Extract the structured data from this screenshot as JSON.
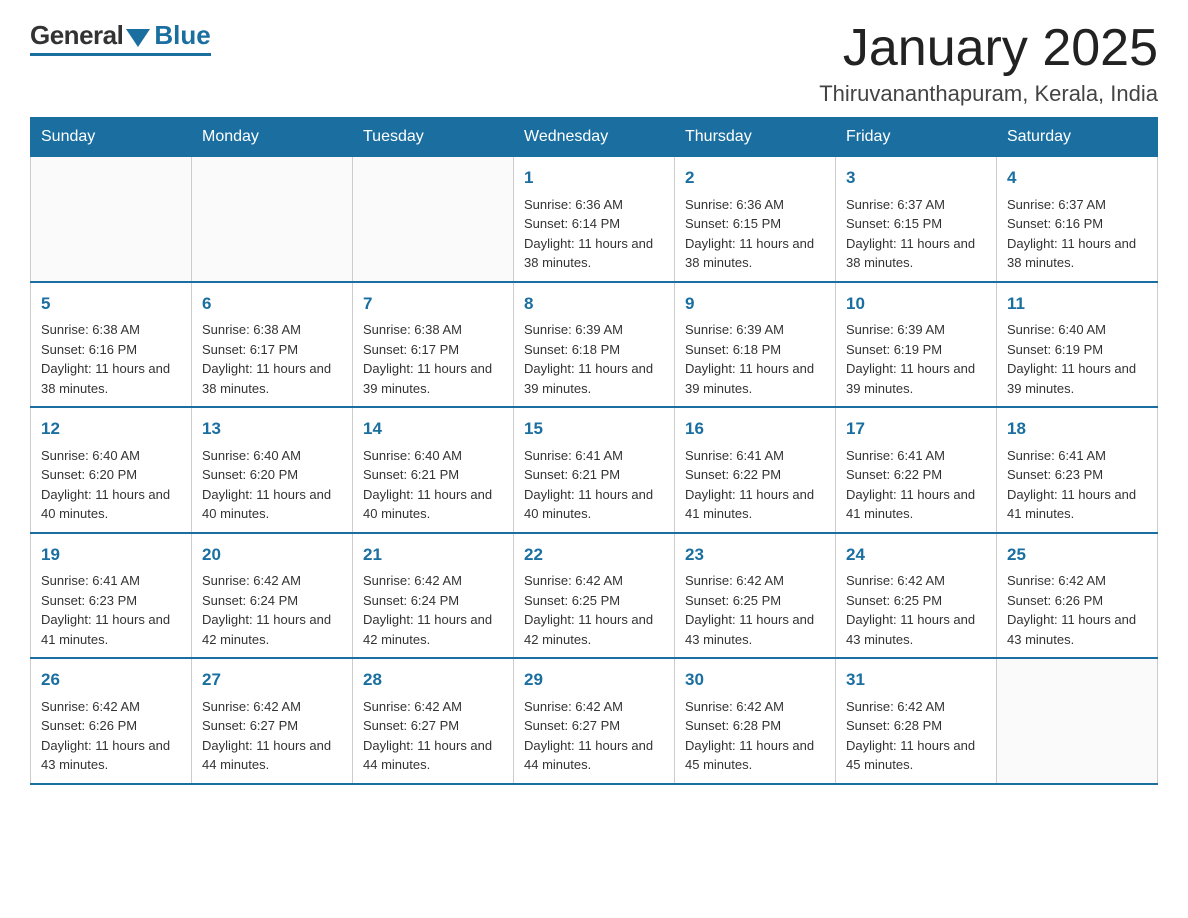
{
  "header": {
    "logo_general": "General",
    "logo_blue": "Blue",
    "month_title": "January 2025",
    "location": "Thiruvananthapuram, Kerala, India"
  },
  "days_of_week": [
    "Sunday",
    "Monday",
    "Tuesday",
    "Wednesday",
    "Thursday",
    "Friday",
    "Saturday"
  ],
  "weeks": [
    [
      {
        "day": "",
        "info": ""
      },
      {
        "day": "",
        "info": ""
      },
      {
        "day": "",
        "info": ""
      },
      {
        "day": "1",
        "info": "Sunrise: 6:36 AM\nSunset: 6:14 PM\nDaylight: 11 hours and 38 minutes."
      },
      {
        "day": "2",
        "info": "Sunrise: 6:36 AM\nSunset: 6:15 PM\nDaylight: 11 hours and 38 minutes."
      },
      {
        "day": "3",
        "info": "Sunrise: 6:37 AM\nSunset: 6:15 PM\nDaylight: 11 hours and 38 minutes."
      },
      {
        "day": "4",
        "info": "Sunrise: 6:37 AM\nSunset: 6:16 PM\nDaylight: 11 hours and 38 minutes."
      }
    ],
    [
      {
        "day": "5",
        "info": "Sunrise: 6:38 AM\nSunset: 6:16 PM\nDaylight: 11 hours and 38 minutes."
      },
      {
        "day": "6",
        "info": "Sunrise: 6:38 AM\nSunset: 6:17 PM\nDaylight: 11 hours and 38 minutes."
      },
      {
        "day": "7",
        "info": "Sunrise: 6:38 AM\nSunset: 6:17 PM\nDaylight: 11 hours and 39 minutes."
      },
      {
        "day": "8",
        "info": "Sunrise: 6:39 AM\nSunset: 6:18 PM\nDaylight: 11 hours and 39 minutes."
      },
      {
        "day": "9",
        "info": "Sunrise: 6:39 AM\nSunset: 6:18 PM\nDaylight: 11 hours and 39 minutes."
      },
      {
        "day": "10",
        "info": "Sunrise: 6:39 AM\nSunset: 6:19 PM\nDaylight: 11 hours and 39 minutes."
      },
      {
        "day": "11",
        "info": "Sunrise: 6:40 AM\nSunset: 6:19 PM\nDaylight: 11 hours and 39 minutes."
      }
    ],
    [
      {
        "day": "12",
        "info": "Sunrise: 6:40 AM\nSunset: 6:20 PM\nDaylight: 11 hours and 40 minutes."
      },
      {
        "day": "13",
        "info": "Sunrise: 6:40 AM\nSunset: 6:20 PM\nDaylight: 11 hours and 40 minutes."
      },
      {
        "day": "14",
        "info": "Sunrise: 6:40 AM\nSunset: 6:21 PM\nDaylight: 11 hours and 40 minutes."
      },
      {
        "day": "15",
        "info": "Sunrise: 6:41 AM\nSunset: 6:21 PM\nDaylight: 11 hours and 40 minutes."
      },
      {
        "day": "16",
        "info": "Sunrise: 6:41 AM\nSunset: 6:22 PM\nDaylight: 11 hours and 41 minutes."
      },
      {
        "day": "17",
        "info": "Sunrise: 6:41 AM\nSunset: 6:22 PM\nDaylight: 11 hours and 41 minutes."
      },
      {
        "day": "18",
        "info": "Sunrise: 6:41 AM\nSunset: 6:23 PM\nDaylight: 11 hours and 41 minutes."
      }
    ],
    [
      {
        "day": "19",
        "info": "Sunrise: 6:41 AM\nSunset: 6:23 PM\nDaylight: 11 hours and 41 minutes."
      },
      {
        "day": "20",
        "info": "Sunrise: 6:42 AM\nSunset: 6:24 PM\nDaylight: 11 hours and 42 minutes."
      },
      {
        "day": "21",
        "info": "Sunrise: 6:42 AM\nSunset: 6:24 PM\nDaylight: 11 hours and 42 minutes."
      },
      {
        "day": "22",
        "info": "Sunrise: 6:42 AM\nSunset: 6:25 PM\nDaylight: 11 hours and 42 minutes."
      },
      {
        "day": "23",
        "info": "Sunrise: 6:42 AM\nSunset: 6:25 PM\nDaylight: 11 hours and 43 minutes."
      },
      {
        "day": "24",
        "info": "Sunrise: 6:42 AM\nSunset: 6:25 PM\nDaylight: 11 hours and 43 minutes."
      },
      {
        "day": "25",
        "info": "Sunrise: 6:42 AM\nSunset: 6:26 PM\nDaylight: 11 hours and 43 minutes."
      }
    ],
    [
      {
        "day": "26",
        "info": "Sunrise: 6:42 AM\nSunset: 6:26 PM\nDaylight: 11 hours and 43 minutes."
      },
      {
        "day": "27",
        "info": "Sunrise: 6:42 AM\nSunset: 6:27 PM\nDaylight: 11 hours and 44 minutes."
      },
      {
        "day": "28",
        "info": "Sunrise: 6:42 AM\nSunset: 6:27 PM\nDaylight: 11 hours and 44 minutes."
      },
      {
        "day": "29",
        "info": "Sunrise: 6:42 AM\nSunset: 6:27 PM\nDaylight: 11 hours and 44 minutes."
      },
      {
        "day": "30",
        "info": "Sunrise: 6:42 AM\nSunset: 6:28 PM\nDaylight: 11 hours and 45 minutes."
      },
      {
        "day": "31",
        "info": "Sunrise: 6:42 AM\nSunset: 6:28 PM\nDaylight: 11 hours and 45 minutes."
      },
      {
        "day": "",
        "info": ""
      }
    ]
  ],
  "colors": {
    "header_bg": "#1a6fa0",
    "header_text": "#ffffff",
    "day_num": "#1a6fa0",
    "border": "#1a6fa0"
  }
}
